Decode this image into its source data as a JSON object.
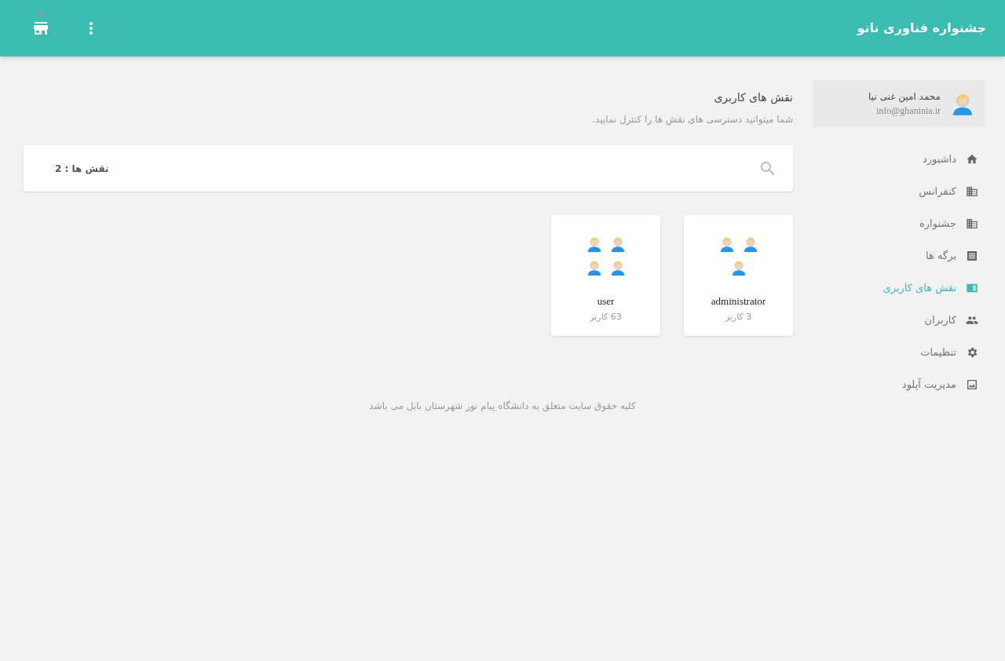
{
  "header": {
    "title": "جشنواره فناوری نانو"
  },
  "profile": {
    "name": "محمد امین غنی نیا",
    "email": "info@ghaninia.ir"
  },
  "sidebar": {
    "items": [
      {
        "label": "داشبورد",
        "kind": "home",
        "selected": false
      },
      {
        "label": "کنفرانس",
        "kind": "building",
        "selected": false
      },
      {
        "label": "جشنواره",
        "kind": "building",
        "selected": false
      },
      {
        "label": "برگه ها",
        "kind": "list",
        "selected": false
      },
      {
        "label": "نقش های کاربری",
        "kind": "panel",
        "selected": true
      },
      {
        "label": "کاربران",
        "kind": "people",
        "selected": false
      },
      {
        "label": "تنظیمات",
        "kind": "gear",
        "selected": false
      },
      {
        "label": "مدیریت آپلود",
        "kind": "image",
        "selected": false
      }
    ]
  },
  "page": {
    "title": "نقش های کاربری",
    "subtitle": "شما میتوانید دسترسی های نقش ها را کنترل نمایید."
  },
  "search_bar": {
    "count": "نقش ها : 2"
  },
  "roles": [
    {
      "name": "administrator",
      "users": "3 کاربر",
      "kind": "trio"
    },
    {
      "name": "user",
      "users": "63 کاربر",
      "kind": "quad"
    }
  ],
  "footer": "کلیه حقوق سایت متعلق به دانشگاه پیام نور شهرستان بابل می باشد"
}
